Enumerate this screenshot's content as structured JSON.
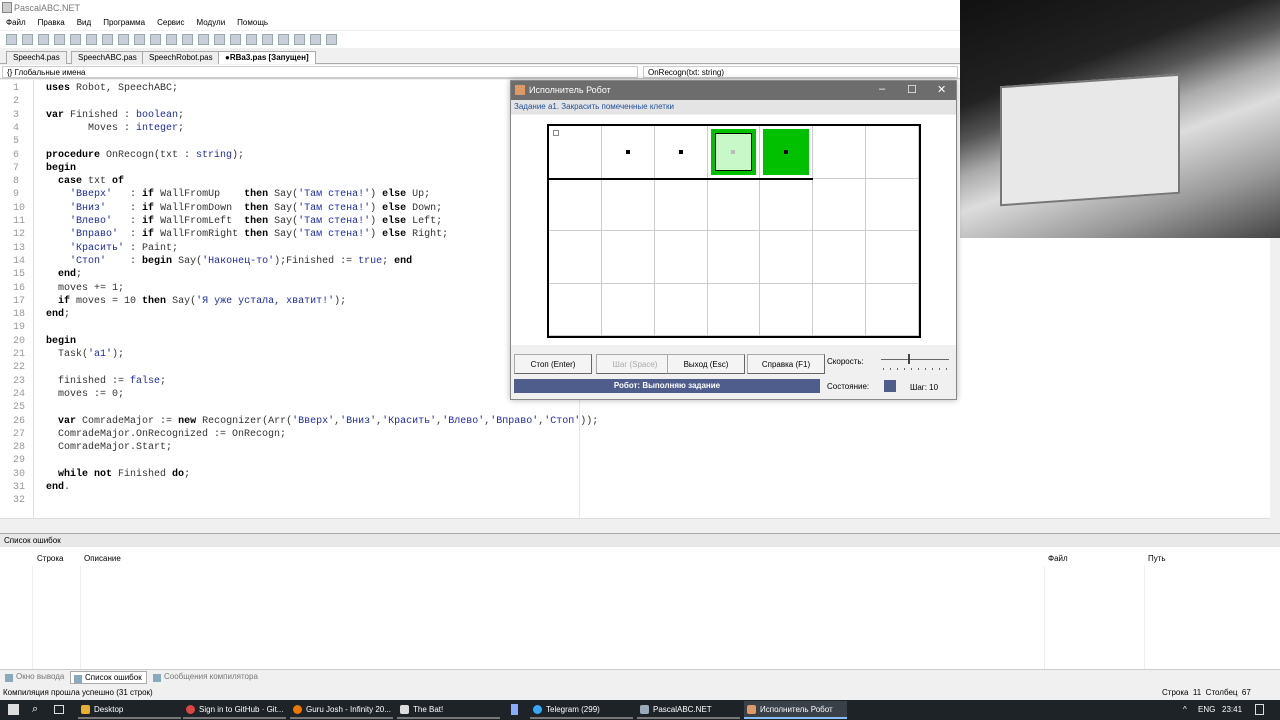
{
  "app": {
    "title": "PascalABC.NET"
  },
  "menu": [
    "Файл",
    "Правка",
    "Вид",
    "Программа",
    "Сервис",
    "Модули",
    "Помощь"
  ],
  "tabs": [
    "Speech4.pas",
    "SpeechABC.pas",
    "SpeechRobot.pas",
    "●RBa3.pas [Запущен]"
  ],
  "nav": {
    "left": "{} Глобальные имена",
    "right": "OnRecogn(txt: string)"
  },
  "code": [
    [
      [
        "k",
        "uses"
      ],
      [
        "n",
        " Robot, SpeechABC;"
      ]
    ],
    [],
    [
      [
        "k",
        "var"
      ],
      [
        "n",
        " Finished : "
      ],
      [
        "s",
        "boolean"
      ],
      [
        "n",
        ";"
      ]
    ],
    [
      [
        "n",
        "       Moves : "
      ],
      [
        "s",
        "integer"
      ],
      [
        "n",
        ";"
      ]
    ],
    [],
    [
      [
        "k",
        "procedure"
      ],
      [
        "n",
        " OnRecogn(txt : "
      ],
      [
        "s",
        "string"
      ],
      [
        "n",
        ");"
      ]
    ],
    [
      [
        "k",
        "begin"
      ]
    ],
    [
      [
        "n",
        "  "
      ],
      [
        "k",
        "case"
      ],
      [
        "n",
        " txt "
      ],
      [
        "k",
        "of"
      ]
    ],
    [
      [
        "n",
        "    "
      ],
      [
        "s",
        "'Вверх'"
      ],
      [
        "n",
        "   : "
      ],
      [
        "k",
        "if"
      ],
      [
        "n",
        " WallFromUp    "
      ],
      [
        "k",
        "then"
      ],
      [
        "n",
        " Say("
      ],
      [
        "s",
        "'Там стена!'"
      ],
      [
        "n",
        ") "
      ],
      [
        "k",
        "else"
      ],
      [
        "n",
        " Up;"
      ]
    ],
    [
      [
        "n",
        "    "
      ],
      [
        "s",
        "'Вниз'"
      ],
      [
        "n",
        "    : "
      ],
      [
        "k",
        "if"
      ],
      [
        "n",
        " WallFromDown  "
      ],
      [
        "k",
        "then"
      ],
      [
        "n",
        " Say("
      ],
      [
        "s",
        "'Там стена!'"
      ],
      [
        "n",
        ") "
      ],
      [
        "k",
        "else"
      ],
      [
        "n",
        " Down;"
      ]
    ],
    [
      [
        "n",
        "    "
      ],
      [
        "s",
        "'Влево'"
      ],
      [
        "n",
        "   : "
      ],
      [
        "k",
        "if"
      ],
      [
        "n",
        " WallFromLeft  "
      ],
      [
        "k",
        "then"
      ],
      [
        "n",
        " Say("
      ],
      [
        "s",
        "'Там стена!'"
      ],
      [
        "n",
        ") "
      ],
      [
        "k",
        "else"
      ],
      [
        "n",
        " Left;"
      ]
    ],
    [
      [
        "n",
        "    "
      ],
      [
        "s",
        "'Вправо'"
      ],
      [
        "n",
        "  : "
      ],
      [
        "k",
        "if"
      ],
      [
        "n",
        " WallFromRight "
      ],
      [
        "k",
        "then"
      ],
      [
        "n",
        " Say("
      ],
      [
        "s",
        "'Там стена!'"
      ],
      [
        "n",
        ") "
      ],
      [
        "k",
        "else"
      ],
      [
        "n",
        " Right;"
      ]
    ],
    [
      [
        "n",
        "    "
      ],
      [
        "s",
        "'Красить'"
      ],
      [
        "n",
        " : Paint;"
      ]
    ],
    [
      [
        "n",
        "    "
      ],
      [
        "s",
        "'Стоп'"
      ],
      [
        "n",
        "    : "
      ],
      [
        "k",
        "begin"
      ],
      [
        "n",
        " Say("
      ],
      [
        "s",
        "'Наконец-то'"
      ],
      [
        "n",
        ");Finished := "
      ],
      [
        "s",
        "true"
      ],
      [
        "n",
        "; "
      ],
      [
        "k",
        "end"
      ]
    ],
    [
      [
        "n",
        "  "
      ],
      [
        "k",
        "end"
      ],
      [
        "n",
        ";"
      ]
    ],
    [
      [
        "n",
        "  moves += 1;"
      ]
    ],
    [
      [
        "n",
        "  "
      ],
      [
        "k",
        "if"
      ],
      [
        "n",
        " moves = 10 "
      ],
      [
        "k",
        "then"
      ],
      [
        "n",
        " Say("
      ],
      [
        "s",
        "'Я уже устала, хватит!'"
      ],
      [
        "n",
        ");"
      ]
    ],
    [
      [
        "k",
        "end"
      ],
      [
        "n",
        ";"
      ]
    ],
    [],
    [
      [
        "k",
        "begin"
      ]
    ],
    [
      [
        "n",
        "  Task("
      ],
      [
        "s",
        "'a1'"
      ],
      [
        "n",
        ");"
      ]
    ],
    [],
    [
      [
        "n",
        "  finished := "
      ],
      [
        "s",
        "false"
      ],
      [
        "n",
        ";"
      ]
    ],
    [
      [
        "n",
        "  moves := 0;"
      ]
    ],
    [],
    [
      [
        "n",
        "  "
      ],
      [
        "k",
        "var"
      ],
      [
        "n",
        " ComradeMajor := "
      ],
      [
        "k",
        "new"
      ],
      [
        "n",
        " Recognizer(Arr("
      ],
      [
        "s",
        "'Вверх'"
      ],
      [
        "n",
        ","
      ],
      [
        "s",
        "'Вниз'"
      ],
      [
        "n",
        ","
      ],
      [
        "s",
        "'Красить'"
      ],
      [
        "n",
        ","
      ],
      [
        "s",
        "'Влево'"
      ],
      [
        "n",
        ","
      ],
      [
        "s",
        "'Вправо'"
      ],
      [
        "n",
        ","
      ],
      [
        "s",
        "'Стоп'"
      ],
      [
        "n",
        "));"
      ]
    ],
    [
      [
        "n",
        "  ComradeMajor.OnRecognized := OnRecogn;"
      ]
    ],
    [
      [
        "n",
        "  ComradeMajor.Start;"
      ]
    ],
    [],
    [
      [
        "n",
        "  "
      ],
      [
        "k",
        "while not"
      ],
      [
        "n",
        " Finished "
      ],
      [
        "k",
        "do"
      ],
      [
        "n",
        ";"
      ]
    ],
    [
      [
        "k",
        "end"
      ],
      [
        "n",
        "."
      ]
    ],
    []
  ],
  "errors": {
    "title": "Список ошибок",
    "columns": [
      "Строка",
      "Описание",
      "Файл",
      "Путь"
    ]
  },
  "bottom_tabs": [
    "Окно вывода",
    "Список ошибок",
    "Сообщения компилятора"
  ],
  "status": {
    "left": "Компиляция прошла успешно (31 строк)",
    "right": "Строка  11  Столбец  67"
  },
  "taskbar": {
    "items": [
      "Desktop",
      "Sign in to GitHub · Git...",
      "Guru Josh - Infinity 20...",
      "The Bat!",
      "Telegram (299)",
      "PascalABC.NET",
      "Исполнитель Робот"
    ],
    "lang": "ENG",
    "time": "23:41"
  },
  "robot": {
    "title": "Исполнитель Робот",
    "task": "Задание a1. Закрасить помеченные клетки",
    "cols": 7,
    "rows": 4,
    "cells": [
      {
        "r": 0,
        "c": 0,
        "start": true
      },
      {
        "r": 0,
        "c": 1,
        "marked": true
      },
      {
        "r": 0,
        "c": 2,
        "marked": true
      },
      {
        "r": 0,
        "c": 3,
        "marked": true,
        "painted": "light",
        "robot": true
      },
      {
        "r": 0,
        "c": 4,
        "marked": true,
        "painted": "full"
      }
    ],
    "buttons": [
      "Стоп (Enter)",
      "Шаг (Space)",
      "Выход (Esc)",
      "Справка (F1)"
    ],
    "status": "Робот: Выполняю задание",
    "speed_label": "Скорость:",
    "speed_fraction": 0.4,
    "state_label": "Состояние:",
    "step": "Шаг: 10",
    "colors": {
      "painted": "#00c000",
      "light": "#c8f8c8",
      "status_bg": "#4e5d8c"
    }
  }
}
